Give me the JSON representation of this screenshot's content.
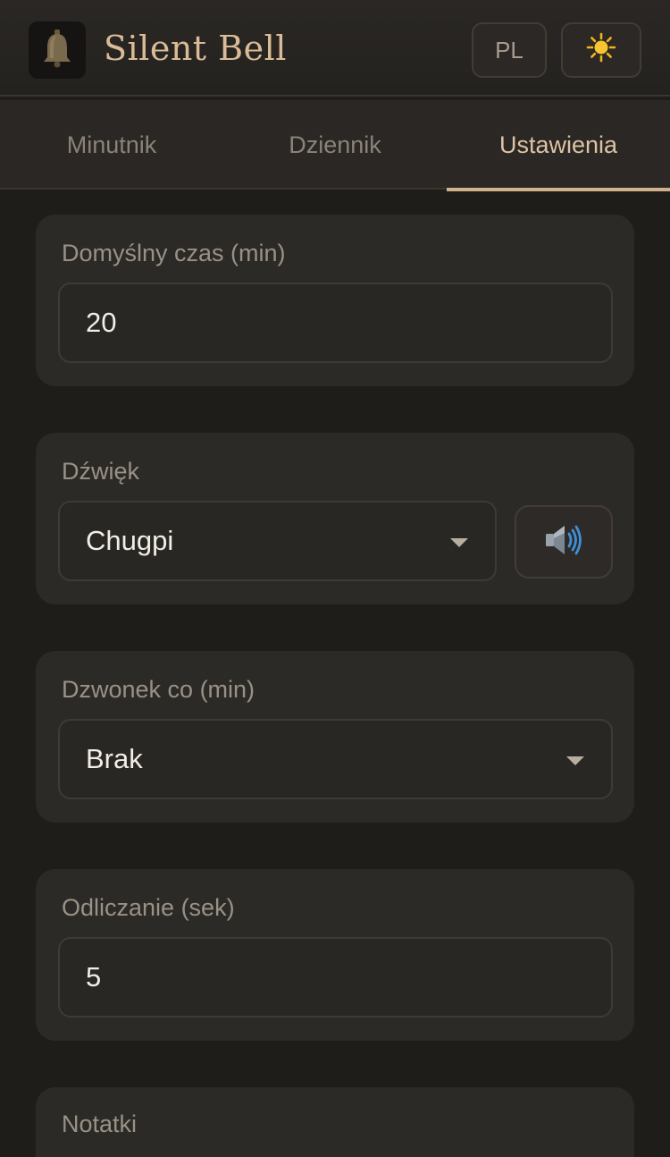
{
  "app": {
    "title": "Silent Bell",
    "logo_icon": "bell-icon"
  },
  "header": {
    "language_label": "PL",
    "theme_icon": "sun-icon"
  },
  "tabs": [
    {
      "label": "Minutnik",
      "active": false
    },
    {
      "label": "Dziennik",
      "active": false
    },
    {
      "label": "Ustawienia",
      "active": true
    }
  ],
  "settings": {
    "default_duration": {
      "label": "Domyślny czas (min)",
      "value": "20"
    },
    "sound": {
      "label": "Dźwięk",
      "selected": "Chugpi",
      "preview_icon": "speaker-icon"
    },
    "interval_bell": {
      "label": "Dzwonek co (min)",
      "selected": "Brak"
    },
    "countdown": {
      "label": "Odliczanie (sek)",
      "value": "5"
    },
    "notes": {
      "label": "Notatki"
    }
  },
  "colors": {
    "background": "#1f1d1a",
    "accent": "#d9bc96",
    "card": "#2c2a26"
  }
}
